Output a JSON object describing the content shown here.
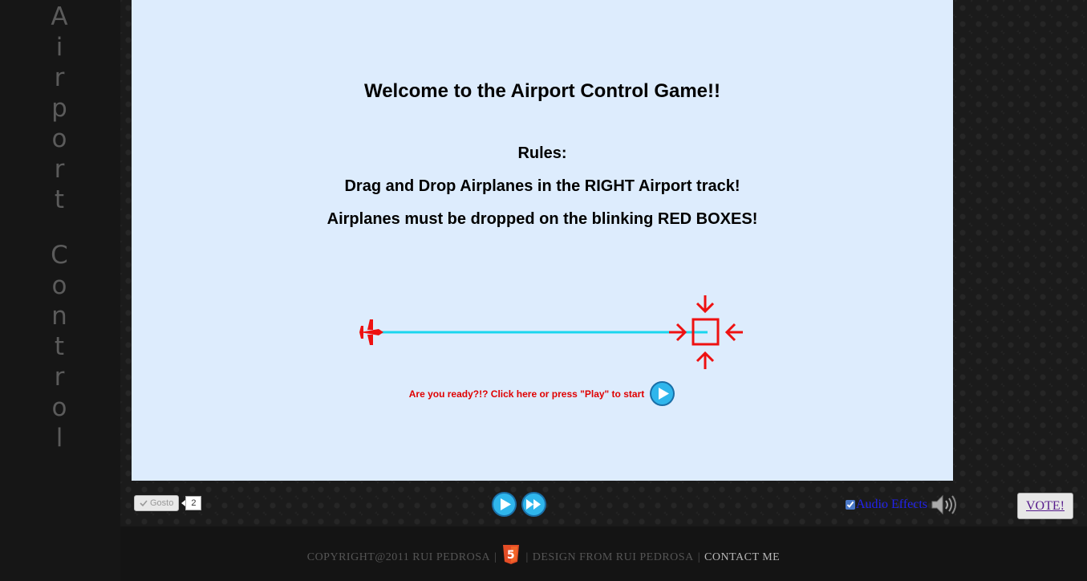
{
  "sidebar": {
    "title_letters": [
      "A",
      "i",
      "r",
      "p",
      "o",
      "r",
      "t",
      "",
      "C",
      "o",
      "n",
      "t",
      "r",
      "o",
      "l"
    ]
  },
  "game": {
    "welcome": "Welcome to the Airport Control Game!!",
    "rules_label": "Rules:",
    "rule_1": "Drag and Drop Airplanes in the RIGHT Airport track!",
    "rule_2": "Airplanes must be dropped on the blinking RED BOXES!",
    "start_prompt": "Are you ready?!? Click here or press \"Play\" to start"
  },
  "social": {
    "like_label": "Gosto",
    "like_count": "2"
  },
  "audio": {
    "label": "Audio Effects",
    "checked": true
  },
  "vote": {
    "label": "VOTE!"
  },
  "footer": {
    "copyright": "COPYRIGHT@2011 RUI PEDROSA",
    "design": "DESIGN FROM RUI PEDROSA",
    "contact": "CONTACT ME",
    "separator": "|",
    "html5_badge": "5"
  },
  "colors": {
    "game_background": "#ddecfd",
    "target_red": "#ee1111",
    "track_cyan": "#1ad6ee",
    "prompt_red": "#e00000"
  },
  "icons": [
    "airplane-icon",
    "target-box-icon",
    "play-icon",
    "fast-forward-icon",
    "speaker-icon",
    "check-icon",
    "html5-logo"
  ]
}
